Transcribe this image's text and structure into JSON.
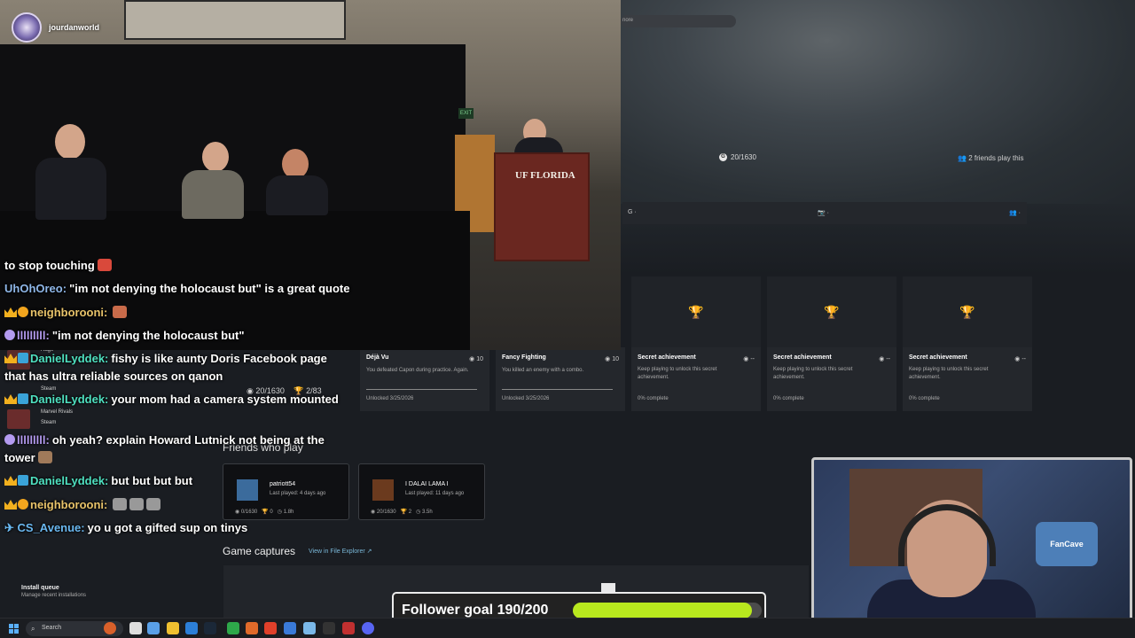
{
  "stream": {
    "handle": "jourdanworld",
    "podium_logo": "UF FLORIDA",
    "exit_sign": "EXIT"
  },
  "app": {
    "search_placeholder": "nore",
    "gamerscore_top": "20/1630",
    "friends_play": "2 friends play this",
    "tabs": [
      "G ·",
      "📷 ·",
      "👥 ·"
    ],
    "sidebar_ghosts": [
      "Rage",
      "Steam",
      "Marvel Rivals",
      "Steam"
    ],
    "overlap_stats": {
      "gamerscore": "20/1630",
      "achievements": "2/83"
    },
    "achievements": [
      {
        "title": "Déjà Vu",
        "points": "10",
        "desc": "You defeated Capon during practice. Again.",
        "status": "Unlocked 3/25/2026",
        "locked": false
      },
      {
        "title": "Fancy Fighting",
        "points": "10",
        "desc": "You killed an enemy with a combo.",
        "status": "Unlocked 3/25/2026",
        "locked": false
      },
      {
        "title": "Secret achievement",
        "points": "--",
        "desc": "Keep playing to unlock this secret achievement.",
        "status": "0% complete",
        "locked": true
      },
      {
        "title": "Secret achievement",
        "points": "--",
        "desc": "Keep playing to unlock this secret achievement.",
        "status": "0% complete",
        "locked": true
      },
      {
        "title": "Secret achievement",
        "points": "--",
        "desc": "Keep playing to unlock this secret achievement.",
        "status": "0% complete",
        "locked": true
      }
    ],
    "friends_title": "Friends who play",
    "friends": [
      {
        "name": "patriott54",
        "last_played": "Last played: 4 days ago",
        "gamerscore": "0/1630",
        "achievements": "0",
        "hours": "1.8h"
      },
      {
        "name": "I DALAI LAMA I",
        "last_played": "Last played: 11 days ago",
        "gamerscore": "20/1630",
        "achievements": "2",
        "hours": "3.5h"
      }
    ],
    "captures_title": "Game captures",
    "view_in_explorer": "View in File Explorer ↗",
    "install_queue": "Install queue",
    "install_sub": "Manage recent installations"
  },
  "chat": [
    {
      "user": "",
      "user_color": "#ffffff",
      "text": "to stop touching",
      "emote": "#d9493b"
    },
    {
      "user": "UhOhOreo:",
      "user_color": "#8fb7e8",
      "text": "\"im not denying the holocaust but\" is a great quote",
      "emote": ""
    },
    {
      "user": "neighborooni:",
      "user_color": "#e8c36a",
      "text": "",
      "emote": "#c96b4a"
    },
    {
      "user": "lllllllll:",
      "user_color": "#b49bf0",
      "text": "\"im not denying the holocaust but\"",
      "emote": ""
    },
    {
      "user": "DanielLyddek:",
      "user_color": "#4fe0c0",
      "text": "fishy is like aunty Doris Facebook page",
      "emote": ""
    },
    {
      "user": "",
      "user_color": "#ffffff",
      "text": "that has ultra reliable sources on qanon",
      "emote": ""
    },
    {
      "user": "DanielLyddek:",
      "user_color": "#4fe0c0",
      "text": "your mom had a camera system mounted",
      "emote": ""
    },
    {
      "user": "lllllllll:",
      "user_color": "#b49bf0",
      "text": "oh yeah? explain Howard Lutnick not being at the",
      "emote": ""
    },
    {
      "user": "",
      "user_color": "#ffffff",
      "text": "tower",
      "emote": "#a07a5a"
    },
    {
      "user": "DanielLyddek:",
      "user_color": "#4fe0c0",
      "text": "but but but but",
      "emote": ""
    },
    {
      "user": "neighborooni:",
      "user_color": "#e8c36a",
      "text": "",
      "emote": "#999999"
    },
    {
      "user": "CS_Avenue:",
      "user_color": "#6ab8f0",
      "text": "yo u got a gifted sup on tinys",
      "emote": ""
    }
  ],
  "webcam": {
    "shirt_tag": "FanCave"
  },
  "goal": {
    "label": "Follower goal 190/200",
    "current": 190,
    "target": 200,
    "fill_color": "#b8e81e"
  },
  "taskbar": {
    "search": "Search"
  }
}
